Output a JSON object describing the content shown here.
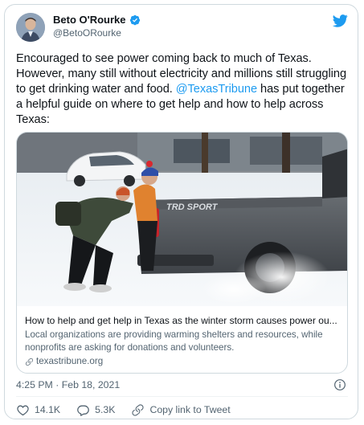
{
  "author": {
    "display_name": "Beto O'Rourke",
    "handle": "@BetoORourke"
  },
  "tweet": {
    "text_before": "Encouraged to see power coming back to much of Texas. However, many still without electricity and millions still struggling to get drinking water and food. ",
    "mention": "@TexasTribune",
    "text_after": " has put together a helpful guide on where to get help and how to help across Texas:",
    "timestamp": "4:25 PM · Feb 18, 2021"
  },
  "link_card": {
    "title": "How to help and get help in Texas as the winter storm causes power ou...",
    "description": "Local organizations are providing warming shelters and resources, while nonprofits are asking for donations and volunteers.",
    "domain": "texastribune.org",
    "truck_badge": "TRD SPORT"
  },
  "actions": {
    "like_count": "14.1K",
    "reply_count": "5.3K",
    "copy_label": "Copy link to Tweet"
  },
  "colors": {
    "accent": "#1d9bf0",
    "text_primary": "#0f1419",
    "text_secondary": "#536471",
    "border": "#cfd9de"
  }
}
